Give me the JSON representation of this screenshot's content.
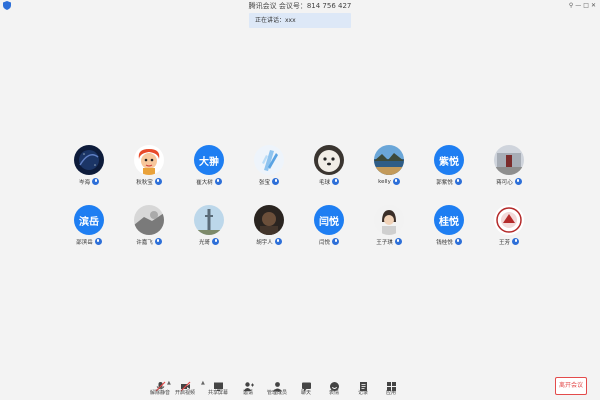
{
  "window": {
    "title": "腾讯会议 会议号：814 756 427",
    "controls": [
      "⚲",
      "—",
      "□",
      "✕"
    ]
  },
  "banner": {
    "text": "正在讲话：xxx"
  },
  "participants": [
    {
      "name": "岑海",
      "avatar_text": "",
      "avatar_kind": "galaxy"
    },
    {
      "name": "秋秋宝",
      "avatar_text": "",
      "avatar_kind": "cartoon"
    },
    {
      "name": "崔大树",
      "avatar_text": "大翀",
      "avatar_kind": "text"
    },
    {
      "name": "张宝",
      "avatar_text": "",
      "avatar_kind": "crystal"
    },
    {
      "name": "毛球",
      "avatar_text": "",
      "avatar_kind": "dog"
    },
    {
      "name": "kelly",
      "avatar_text": "",
      "avatar_kind": "landscape"
    },
    {
      "name": "郭紫悦",
      "avatar_text": "紫悦",
      "avatar_kind": "text"
    },
    {
      "name": "蒋可心",
      "avatar_text": "",
      "avatar_kind": "street"
    },
    {
      "name": "邵滨岳",
      "avatar_text": "滨岳",
      "avatar_kind": "text"
    },
    {
      "name": "许嘉飞",
      "avatar_text": "",
      "avatar_kind": "grey"
    },
    {
      "name": "光哥",
      "avatar_text": "",
      "avatar_kind": "tower"
    },
    {
      "name": "胡宇人",
      "avatar_text": "",
      "avatar_kind": "dark"
    },
    {
      "name": "闫悦",
      "avatar_text": "闫悦",
      "avatar_kind": "text"
    },
    {
      "name": "王子琪",
      "avatar_text": "",
      "avatar_kind": "person"
    },
    {
      "name": "钱桂悦",
      "avatar_text": "桂悦",
      "avatar_kind": "text"
    },
    {
      "name": "王芳",
      "avatar_text": "",
      "avatar_kind": "seal"
    }
  ],
  "toolbar": [
    {
      "label": "解除静音",
      "icon": "mic-muted-icon"
    },
    {
      "label": "开启视频",
      "icon": "video-off-icon"
    },
    {
      "label": "共享屏幕",
      "icon": "share-screen-icon"
    },
    {
      "label": "邀请",
      "icon": "invite-icon"
    },
    {
      "label": "管理成员",
      "icon": "members-icon"
    },
    {
      "label": "聊天",
      "icon": "chat-icon"
    },
    {
      "label": "表情",
      "icon": "emoji-icon"
    },
    {
      "label": "记录",
      "icon": "notes-icon"
    },
    {
      "label": "应用",
      "icon": "apps-icon"
    }
  ],
  "leave": {
    "label": "离开会议"
  },
  "colors": {
    "accent": "#1e7ef2",
    "leave": "#e34b4b",
    "background": "#f3f3f3"
  }
}
